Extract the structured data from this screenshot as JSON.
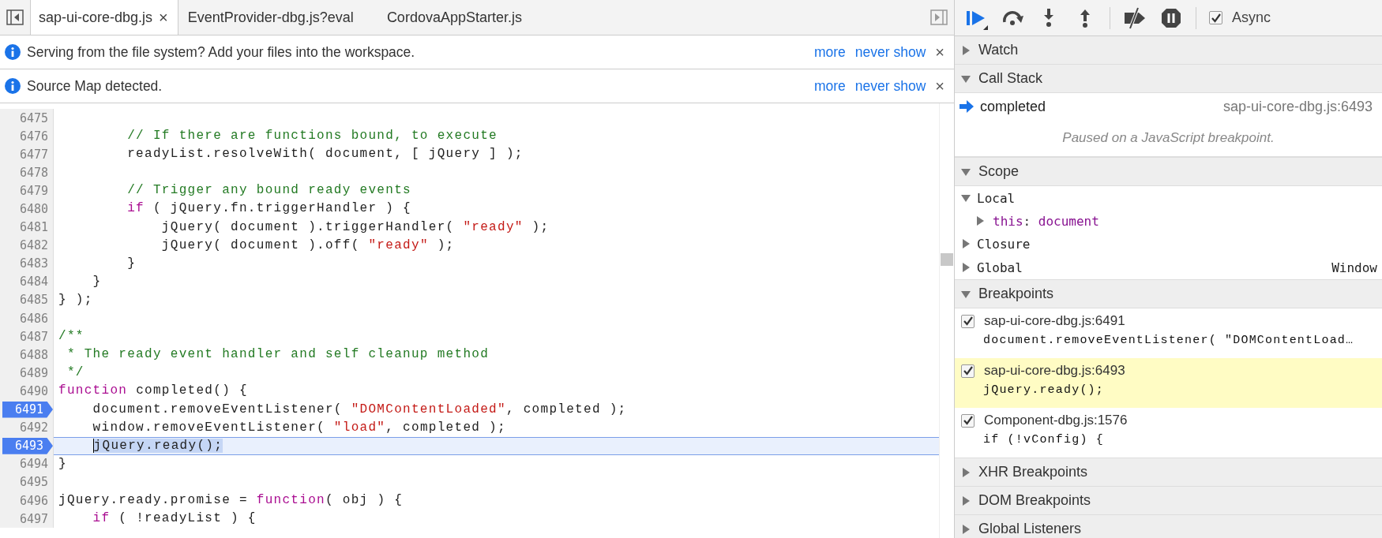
{
  "tab_bar": {
    "tabs": [
      {
        "label": "sap-ui-core-dbg.js",
        "selected": true,
        "close": "×"
      },
      {
        "label": "EventProvider-dbg.js?eval",
        "selected": false
      },
      {
        "label": "CordovaAppStarter.js",
        "selected": false
      }
    ]
  },
  "banners": [
    {
      "message": "Serving from the file system? Add your files into the workspace.",
      "links": [
        "more",
        "never show"
      ],
      "close": "×"
    },
    {
      "message": "Source Map detected.",
      "links": [
        "more",
        "never show"
      ],
      "close": "×"
    }
  ],
  "editor": {
    "lines": [
      {
        "number": "6475",
        "breakpoint": false,
        "current": false
      },
      {
        "number": "6476",
        "breakpoint": false,
        "current": false,
        "tokens": [
          {
            "kind": "comment",
            "text": "        // If there are functions bound, to execute"
          }
        ]
      },
      {
        "number": "6477",
        "breakpoint": false,
        "current": false,
        "tokens": [
          {
            "kind": "plain",
            "text": "        readyList.resolveWith( document, [ jQuery ] );"
          }
        ]
      },
      {
        "number": "6478",
        "breakpoint": false,
        "current": false
      },
      {
        "number": "6479",
        "breakpoint": false,
        "current": false,
        "tokens": [
          {
            "kind": "comment",
            "text": "        // Trigger any bound ready events"
          }
        ]
      },
      {
        "number": "6480",
        "breakpoint": false,
        "current": false,
        "tokens": [
          {
            "kind": "keyword",
            "text": "        if"
          },
          {
            "kind": "plain",
            "text": " ( jQuery.fn.triggerHandler ) {"
          }
        ]
      },
      {
        "number": "6481",
        "breakpoint": false,
        "current": false,
        "tokens": [
          {
            "kind": "plain",
            "text": "            jQuery( document ).triggerHandler( "
          },
          {
            "kind": "string",
            "text": "\"ready\""
          },
          {
            "kind": "plain",
            "text": " );"
          }
        ]
      },
      {
        "number": "6482",
        "breakpoint": false,
        "current": false,
        "tokens": [
          {
            "kind": "plain",
            "text": "            jQuery( document ).off( "
          },
          {
            "kind": "string",
            "text": "\"ready\""
          },
          {
            "kind": "plain",
            "text": " );"
          }
        ]
      },
      {
        "number": "6483",
        "breakpoint": false,
        "current": false,
        "tokens": [
          {
            "kind": "plain",
            "text": "        }"
          }
        ]
      },
      {
        "number": "6484",
        "breakpoint": false,
        "current": false,
        "tokens": [
          {
            "kind": "plain",
            "text": "    }"
          }
        ]
      },
      {
        "number": "6485",
        "breakpoint": false,
        "current": false,
        "tokens": [
          {
            "kind": "plain",
            "text": "} );"
          }
        ]
      },
      {
        "number": "6486",
        "breakpoint": false,
        "current": false
      },
      {
        "number": "6487",
        "breakpoint": false,
        "current": false,
        "tokens": [
          {
            "kind": "comment",
            "text": "/**"
          }
        ]
      },
      {
        "number": "6488",
        "breakpoint": false,
        "current": false,
        "tokens": [
          {
            "kind": "comment",
            "text": " * The ready event handler and self cleanup method"
          }
        ]
      },
      {
        "number": "6489",
        "breakpoint": false,
        "current": false,
        "tokens": [
          {
            "kind": "comment",
            "text": " */"
          }
        ]
      },
      {
        "number": "6490",
        "breakpoint": false,
        "current": false,
        "tokens": [
          {
            "kind": "keyword",
            "text": "function"
          },
          {
            "kind": "plain",
            "text": " completed() {"
          }
        ]
      },
      {
        "number": "6491",
        "breakpoint": true,
        "current": false,
        "tokens": [
          {
            "kind": "plain",
            "text": "    document.removeEventListener( "
          },
          {
            "kind": "string",
            "text": "\"DOMContentLoaded\""
          },
          {
            "kind": "plain",
            "text": ", completed );"
          }
        ]
      },
      {
        "number": "6492",
        "breakpoint": false,
        "current": false,
        "tokens": [
          {
            "kind": "plain",
            "text": "    window.removeEventListener( "
          },
          {
            "kind": "string",
            "text": "\"load\""
          },
          {
            "kind": "plain",
            "text": ", completed );"
          }
        ]
      },
      {
        "number": "6493",
        "breakpoint": true,
        "current": true,
        "tokens": [
          {
            "kind": "selection",
            "text": "    jQuery.ready();"
          }
        ]
      },
      {
        "number": "6494",
        "breakpoint": false,
        "current": false,
        "tokens": [
          {
            "kind": "plain",
            "text": "}"
          }
        ]
      },
      {
        "number": "6495",
        "breakpoint": false,
        "current": false
      },
      {
        "number": "6496",
        "breakpoint": false,
        "current": false,
        "tokens": [
          {
            "kind": "plain",
            "text": "jQuery.ready.promise = "
          },
          {
            "kind": "keyword",
            "text": "function"
          },
          {
            "kind": "plain",
            "text": "( obj ) {"
          }
        ]
      },
      {
        "number": "6497",
        "breakpoint": false,
        "current": false,
        "tokens": [
          {
            "kind": "keyword",
            "text": "    if"
          },
          {
            "kind": "plain",
            "text": " ( !readyList ) {"
          }
        ]
      }
    ]
  },
  "debugger": {
    "toolbar": {
      "async": {
        "label": "Async",
        "checked": true
      }
    },
    "sections": [
      {
        "title": "Watch",
        "expanded": false
      },
      {
        "title": "Call Stack",
        "expanded": true,
        "frames": [
          {
            "name": "completed",
            "location": "sap-ui-core-dbg.js:6493",
            "current": true
          }
        ],
        "message": "Paused on a JavaScript breakpoint."
      },
      {
        "title": "Scope",
        "expanded": true,
        "scopes": [
          {
            "label": "Local",
            "expanded": true,
            "children": [
              {
                "name": "this",
                "separator": ": ",
                "value": "document",
                "expanded": false
              }
            ]
          },
          {
            "label": "Closure",
            "expanded": false
          },
          {
            "label": "Global",
            "expanded": false,
            "value": "Window"
          }
        ]
      },
      {
        "title": "Breakpoints",
        "expanded": true,
        "breakpoints": [
          {
            "location": "sap-ui-core-dbg.js:6491",
            "code": "document.removeEventListener( \"DOMContentLoad…",
            "checked": true,
            "selected": false
          },
          {
            "location": "sap-ui-core-dbg.js:6493",
            "code": "jQuery.ready();",
            "checked": true,
            "selected": true
          },
          {
            "location": "Component-dbg.js:1576",
            "code": "if (!vConfig) {",
            "checked": true,
            "selected": false
          }
        ]
      },
      {
        "title": "XHR Breakpoints",
        "expanded": false
      },
      {
        "title": "DOM Breakpoints",
        "expanded": false
      },
      {
        "title": "Global Listeners",
        "expanded": false
      }
    ]
  }
}
